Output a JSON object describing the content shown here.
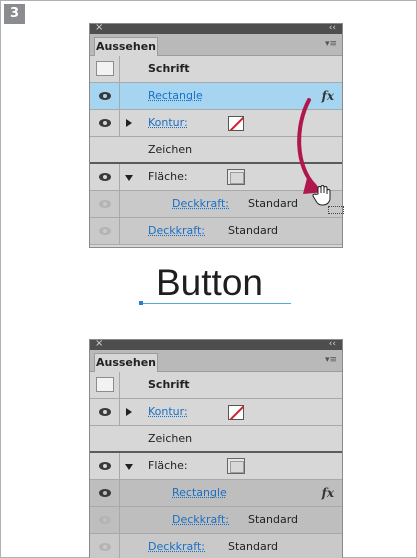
{
  "step": "3",
  "colors": {
    "selected_row": "#a6d5f1",
    "link": "#1a6fc4",
    "arrow": "#b0174e",
    "stroke_swatch": "#d11f2b"
  },
  "panel_top": {
    "title": "Aussehen",
    "rows": [
      {
        "type": "object",
        "label": "Schrift"
      },
      {
        "type": "selected",
        "label": "Rectangle",
        "fx": "fx"
      },
      {
        "type": "kontur",
        "label": "Kontur:"
      },
      {
        "type": "plain",
        "label": "Zeichen"
      },
      {
        "type": "flaeche",
        "label": "Fläche:"
      },
      {
        "type": "opacity-indent",
        "label": "Deckkraft:",
        "value": "Standard"
      },
      {
        "type": "opacity",
        "label": "Deckkraft:",
        "value": "Standard"
      }
    ]
  },
  "text_object": {
    "text": "Button"
  },
  "panel_bottom": {
    "title": "Aussehen",
    "rows": [
      {
        "type": "object",
        "label": "Schrift"
      },
      {
        "type": "kontur",
        "label": "Kontur:"
      },
      {
        "type": "plain",
        "label": "Zeichen"
      },
      {
        "type": "flaeche",
        "label": "Fläche:"
      },
      {
        "type": "effect",
        "label": "Rectangle",
        "fx": "fx"
      },
      {
        "type": "opacity-indent",
        "label": "Deckkraft:",
        "value": "Standard"
      },
      {
        "type": "opacity",
        "label": "Deckkraft:",
        "value": "Standard"
      }
    ]
  }
}
